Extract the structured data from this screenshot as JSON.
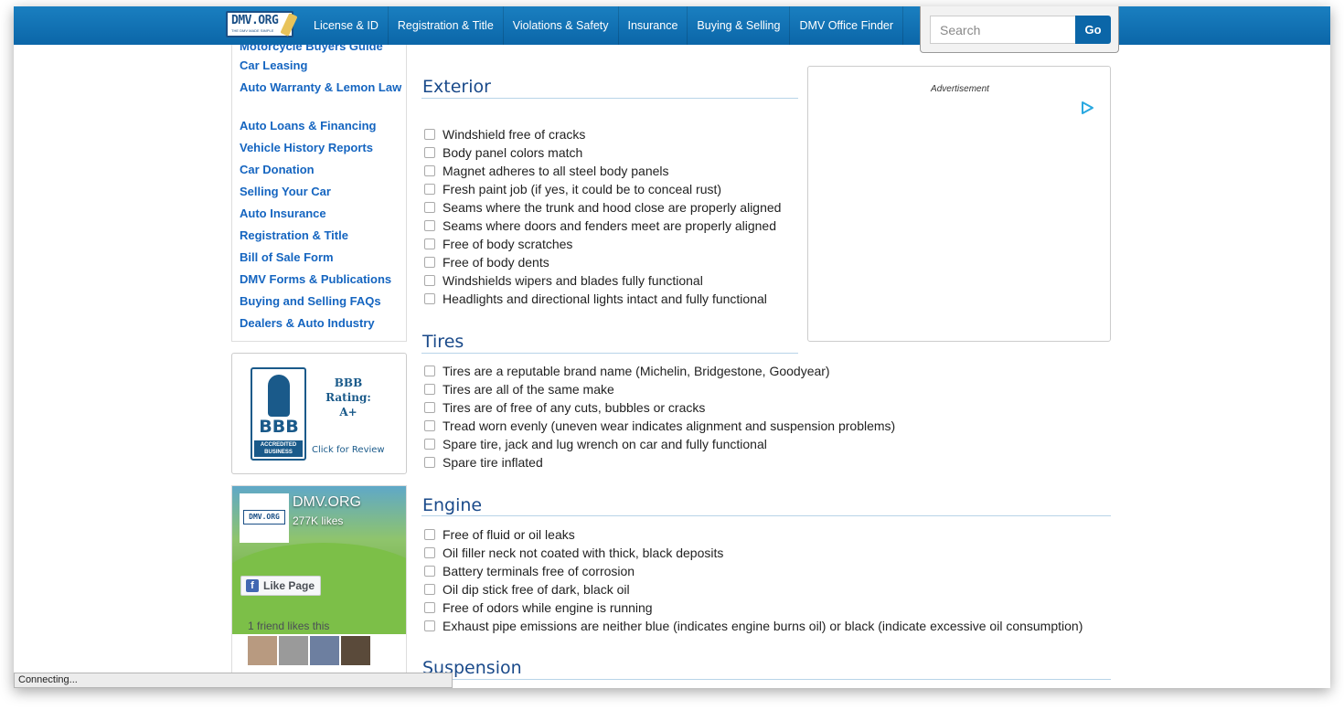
{
  "nav": {
    "logo_text": "DMV.ORG",
    "logo_sub": "THE DMV MADE SIMPLE",
    "items": [
      "License & ID",
      "Registration & Title",
      "Violations & Safety",
      "Insurance",
      "Buying & Selling",
      "DMV Office Finder"
    ],
    "search_placeholder": "Search",
    "go_label": "Go"
  },
  "sidebar": {
    "links": [
      "Motorcycle Buyers Guide",
      "Car Leasing",
      "Auto Warranty & Lemon Law",
      "Auto Loans & Financing",
      "Vehicle History Reports",
      "Car Donation",
      "Selling Your Car",
      "Auto Insurance",
      "Registration & Title",
      "Bill of Sale Form",
      "DMV Forms & Publications",
      "Buying and Selling FAQs",
      "Dealers & Auto Industry"
    ]
  },
  "bbb": {
    "letters": "BBB",
    "accredited": "ACCREDITED BUSINESS",
    "rating_line1": "BBB",
    "rating_line2": "Rating:",
    "rating_line3": "A+",
    "click": "Click for Review"
  },
  "facebook": {
    "name": "DMV.ORG",
    "likes": "277K likes",
    "like_button": "Like Page",
    "friends_text": "1 friend likes this",
    "profile_logo": "DMV.ORG"
  },
  "sections": [
    {
      "title": "Exterior",
      "items": [
        "Windshield free of cracks",
        "Body panel colors match",
        "Magnet adheres to all steel body panels",
        "Fresh paint job (if yes, it could be to conceal rust)",
        "Seams where the trunk and hood close are properly aligned",
        "Seams where doors and fenders meet are properly aligned",
        "Free of body scratches",
        "Free of body dents",
        "Windshields wipers and blades fully functional",
        "Headlights and directional lights intact and fully functional"
      ]
    },
    {
      "title": "Tires",
      "items": [
        "Tires are a reputable brand name (Michelin, Bridgestone, Goodyear)",
        "Tires are all of the same make",
        "Tires are of free of any cuts, bubbles or cracks",
        "Tread worn evenly (uneven wear indicates alignment and suspension problems)",
        "Spare tire, jack and lug wrench on car and fully functional",
        "Spare tire inflated"
      ]
    },
    {
      "title": "Engine",
      "items": [
        "Free of fluid or oil leaks",
        "Oil filler neck not coated with thick, black deposits",
        "Battery terminals free of corrosion",
        "Oil dip stick free of dark, black oil",
        "Free of odors while engine is running",
        "Exhaust pipe emissions are neither blue (indicates engine burns oil) or black (indicate excessive oil consumption)"
      ]
    },
    {
      "title": "Suspension",
      "items": []
    }
  ],
  "ad": {
    "label": "Advertisement",
    "icon": "adchoices-icon"
  },
  "status": {
    "text": "Connecting..."
  }
}
